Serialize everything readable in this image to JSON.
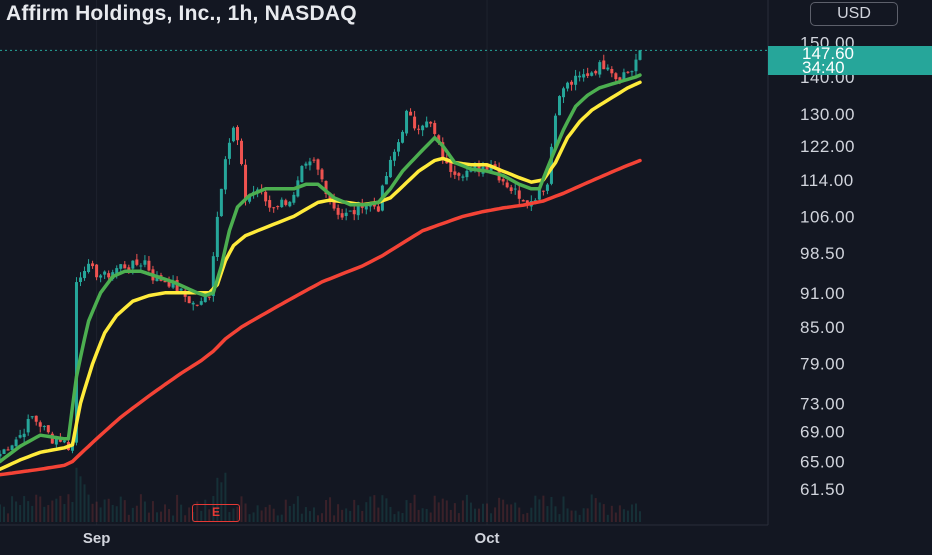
{
  "header": {
    "title": "Affirm Holdings, Inc., 1h, NASDAQ",
    "currency": "USD"
  },
  "price_badge": {
    "price": "147.60",
    "countdown": "34:40",
    "color": "#26a69a"
  },
  "earnings_marker": {
    "label": "E",
    "color": "#e53935"
  },
  "colors": {
    "background": "#131722",
    "up": "#26a69a",
    "down": "#ef5350",
    "ma_fast": "#4caf50",
    "ma_mid": "#ffeb3b",
    "ma_slow": "#f44336"
  },
  "chart_data": {
    "type": "candlestick",
    "title": "Affirm Holdings, Inc., 1h, NASDAQ",
    "y_scale": "log",
    "ylim": [
      59,
      160
    ],
    "y_ticks": [
      "150.00",
      "140.00",
      "130.00",
      "122.00",
      "114.00",
      "106.00",
      "98.50",
      "91.00",
      "85.00",
      "79.00",
      "73.00",
      "69.00",
      "65.00",
      "61.50"
    ],
    "x_ticks": [
      {
        "label": "Sep",
        "bar": 24
      },
      {
        "label": "Oct",
        "bar": 121
      }
    ],
    "last_price": 147.6,
    "bars_count": 160,
    "price_anchors": [
      [
        0,
        66
      ],
      [
        2,
        67
      ],
      [
        5,
        68.5
      ],
      [
        8,
        71
      ],
      [
        10,
        70
      ],
      [
        13,
        68
      ],
      [
        15,
        68
      ],
      [
        17,
        67
      ],
      [
        18,
        67.5
      ],
      [
        19,
        93
      ],
      [
        21,
        96
      ],
      [
        23,
        95
      ],
      [
        26,
        94
      ],
      [
        30,
        96
      ],
      [
        33,
        96
      ],
      [
        36,
        97
      ],
      [
        38,
        94
      ],
      [
        42,
        93
      ],
      [
        45,
        91
      ],
      [
        48,
        89
      ],
      [
        50,
        89
      ],
      [
        52,
        91
      ],
      [
        54,
        106
      ],
      [
        56,
        120
      ],
      [
        58,
        126
      ],
      [
        59,
        123
      ],
      [
        61,
        110
      ],
      [
        64,
        112
      ],
      [
        67,
        108
      ],
      [
        70,
        109
      ],
      [
        73,
        110
      ],
      [
        75,
        116
      ],
      [
        78,
        118
      ],
      [
        80,
        114
      ],
      [
        83,
        108
      ],
      [
        85,
        106
      ],
      [
        88,
        107
      ],
      [
        90,
        109
      ],
      [
        94,
        108
      ],
      [
        96,
        115
      ],
      [
        99,
        123
      ],
      [
        101,
        130
      ],
      [
        103,
        127
      ],
      [
        105,
        128
      ],
      [
        107,
        127
      ],
      [
        109,
        122
      ],
      [
        111,
        117
      ],
      [
        114,
        116
      ],
      [
        117,
        116
      ],
      [
        120,
        117
      ],
      [
        122,
        118
      ],
      [
        124,
        115
      ],
      [
        127,
        112
      ],
      [
        130,
        110
      ],
      [
        132,
        109
      ],
      [
        134,
        112
      ],
      [
        136,
        113
      ],
      [
        138,
        131
      ],
      [
        140,
        137
      ],
      [
        143,
        139
      ],
      [
        146,
        141
      ],
      [
        149,
        143
      ],
      [
        151,
        144
      ],
      [
        153,
        140
      ],
      [
        155,
        141
      ],
      [
        157,
        142
      ],
      [
        159,
        147.6
      ]
    ],
    "ma_fast_anchors": [
      [
        0,
        65
      ],
      [
        5,
        67
      ],
      [
        10,
        68.5
      ],
      [
        16,
        68
      ],
      [
        17,
        68
      ],
      [
        19,
        77
      ],
      [
        22,
        86
      ],
      [
        25,
        91
      ],
      [
        28,
        94
      ],
      [
        31,
        95
      ],
      [
        35,
        95
      ],
      [
        39,
        94
      ],
      [
        43,
        93
      ],
      [
        46,
        92
      ],
      [
        49,
        91
      ],
      [
        51,
        90.5
      ],
      [
        53,
        91
      ],
      [
        55,
        96
      ],
      [
        57,
        103
      ],
      [
        59,
        108
      ],
      [
        62,
        110.5
      ],
      [
        66,
        112
      ],
      [
        70,
        112
      ],
      [
        73,
        112
      ],
      [
        76,
        113
      ],
      [
        79,
        113
      ],
      [
        83,
        110
      ],
      [
        87,
        108.5
      ],
      [
        91,
        108.5
      ],
      [
        94,
        109
      ],
      [
        97,
        112
      ],
      [
        100,
        116
      ],
      [
        103,
        119
      ],
      [
        106,
        122
      ],
      [
        108,
        124
      ],
      [
        110,
        122
      ],
      [
        113,
        118
      ],
      [
        117,
        116.5
      ],
      [
        121,
        116
      ],
      [
        125,
        115
      ],
      [
        129,
        113
      ],
      [
        132,
        112
      ],
      [
        134,
        112
      ],
      [
        137,
        119
      ],
      [
        140,
        126
      ],
      [
        143,
        132
      ],
      [
        146,
        135
      ],
      [
        149,
        137
      ],
      [
        152,
        138
      ],
      [
        155,
        139
      ],
      [
        158,
        140
      ],
      [
        159,
        140.5
      ]
    ],
    "ma_mid_anchors": [
      [
        0,
        64
      ],
      [
        5,
        65.2
      ],
      [
        10,
        66.2
      ],
      [
        16,
        66.8
      ],
      [
        18,
        67.2
      ],
      [
        20,
        73
      ],
      [
        23,
        79
      ],
      [
        26,
        84
      ],
      [
        29,
        87
      ],
      [
        33,
        89.5
      ],
      [
        37,
        90.5
      ],
      [
        41,
        91
      ],
      [
        45,
        91
      ],
      [
        49,
        91
      ],
      [
        52,
        91
      ],
      [
        54,
        92.5
      ],
      [
        56,
        97
      ],
      [
        58,
        100
      ],
      [
        61,
        102
      ],
      [
        64,
        103
      ],
      [
        67,
        104
      ],
      [
        70,
        105
      ],
      [
        73,
        106
      ],
      [
        76,
        107.5
      ],
      [
        79,
        109
      ],
      [
        82,
        109.5
      ],
      [
        86,
        109
      ],
      [
        90,
        108.5
      ],
      [
        94,
        109
      ],
      [
        97,
        110
      ],
      [
        100,
        112.5
      ],
      [
        104,
        116
      ],
      [
        108,
        118.5
      ],
      [
        110,
        119
      ],
      [
        113,
        118
      ],
      [
        117,
        117.5
      ],
      [
        121,
        117.5
      ],
      [
        125,
        116
      ],
      [
        129,
        114.5
      ],
      [
        132,
        113.5
      ],
      [
        135,
        114
      ],
      [
        138,
        118
      ],
      [
        141,
        124
      ],
      [
        144,
        128
      ],
      [
        147,
        131
      ],
      [
        150,
        133
      ],
      [
        153,
        135
      ],
      [
        156,
        137
      ],
      [
        159,
        138.5
      ]
    ],
    "ma_slow_anchors": [
      [
        0,
        63.3
      ],
      [
        10,
        64
      ],
      [
        16,
        64.5
      ],
      [
        18,
        65
      ],
      [
        23,
        67.5
      ],
      [
        30,
        71
      ],
      [
        38,
        74.5
      ],
      [
        45,
        77.5
      ],
      [
        50,
        79.5
      ],
      [
        53,
        81
      ],
      [
        56,
        83
      ],
      [
        60,
        85
      ],
      [
        65,
        87
      ],
      [
        70,
        89
      ],
      [
        75,
        91
      ],
      [
        80,
        93
      ],
      [
        85,
        94.5
      ],
      [
        90,
        96
      ],
      [
        95,
        98
      ],
      [
        100,
        100.5
      ],
      [
        105,
        103
      ],
      [
        110,
        104.5
      ],
      [
        115,
        106
      ],
      [
        120,
        107
      ],
      [
        125,
        107.8
      ],
      [
        130,
        108.4
      ],
      [
        135,
        109.3
      ],
      [
        140,
        111
      ],
      [
        145,
        113
      ],
      [
        150,
        115
      ],
      [
        155,
        117
      ],
      [
        159,
        118.5
      ]
    ]
  }
}
